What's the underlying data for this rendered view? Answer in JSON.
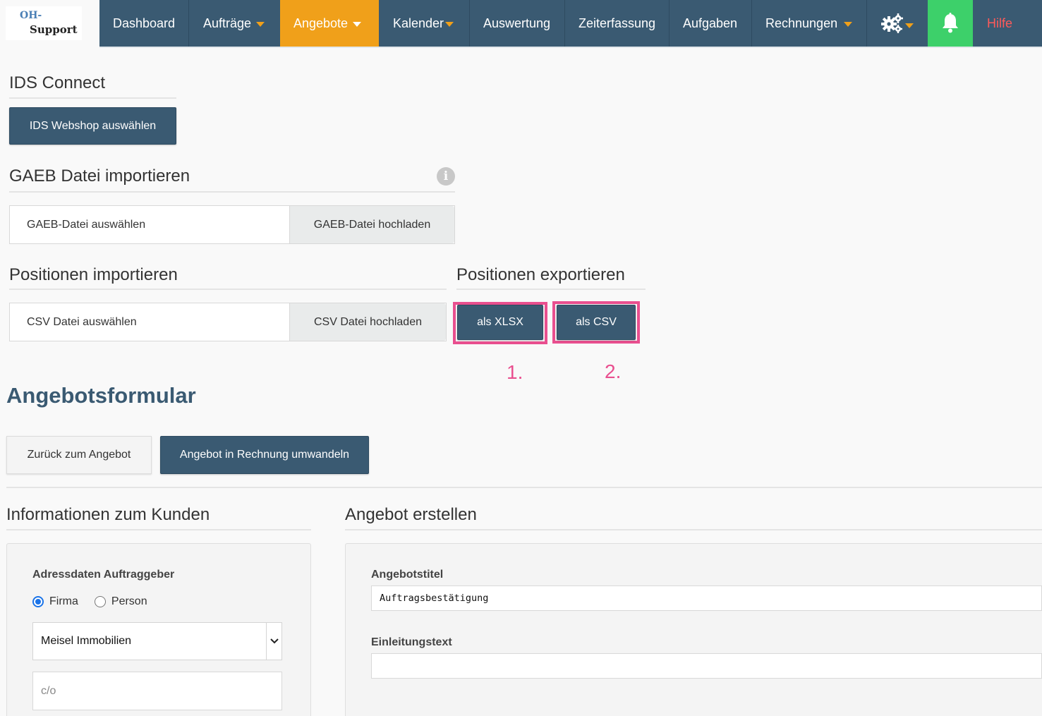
{
  "logo": {
    "line1": "OH-",
    "line2": "Support"
  },
  "nav": {
    "dashboard": "Dashboard",
    "auftraege": "Aufträge",
    "angebote": "Angebote",
    "kalender": "Kalender",
    "auswertung": "Auswertung",
    "zeiterfassung": "Zeiterfassung",
    "aufgaben": "Aufgaben",
    "rechnungen": "Rechnungen",
    "hilfe": "Hilfe",
    "settings_icon": "gears-icon",
    "bell_icon": "bell-icon"
  },
  "ids": {
    "title": "IDS Connect",
    "button": "IDS Webshop auswählen"
  },
  "gaeb": {
    "title": "GAEB Datei importieren",
    "select": "GAEB-Datei auswählen",
    "upload": "GAEB-Datei hochladen",
    "info_icon": "info-icon"
  },
  "positions_import": {
    "title": "Positionen importieren",
    "select": "CSV Datei auswählen",
    "upload": "CSV Datei hochladen"
  },
  "positions_export": {
    "title": "Positionen exportieren",
    "xlsx": "als XLSX",
    "csv": "als CSV",
    "step1": "1.",
    "step2": "2."
  },
  "form": {
    "title": "Angebotsformular",
    "back": "Zurück zum Angebot",
    "convert": "Angebot in Rechnung umwandeln"
  },
  "customer": {
    "title": "Informationen zum Kunden",
    "address_label": "Adressdaten Auftraggeber",
    "radio_firma": "Firma",
    "radio_person": "Person",
    "selected": "Meisel Immobilien",
    "co_placeholder": "c/o"
  },
  "offer": {
    "title": "Angebot erstellen",
    "title_label": "Angebotstitel",
    "title_value": "Auftragsbestätigung",
    "intro_label": "Einleitungstext",
    "intro_value": ""
  },
  "colors": {
    "primary": "#3a5a72",
    "accent": "#f0a01a",
    "highlight": "#e94f8f",
    "bell": "#3dd06a",
    "help": "#ff5a5a"
  }
}
